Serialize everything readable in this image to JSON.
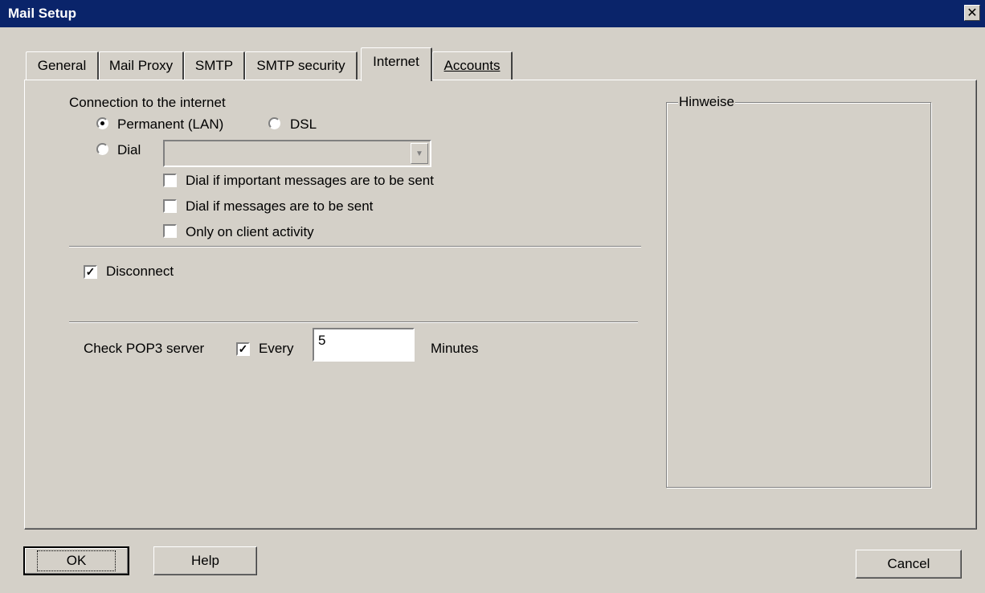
{
  "window": {
    "title": "Mail Setup",
    "close_symbol": "✕"
  },
  "tabs": [
    {
      "label": "General"
    },
    {
      "label": "Mail Proxy"
    },
    {
      "label": "SMTP"
    },
    {
      "label": "SMTP security"
    },
    {
      "label": "Internet",
      "active": true
    },
    {
      "label": "Accounts"
    }
  ],
  "internet": {
    "connection_label": "Connection to the internet",
    "radio_permanent": "Permanent (LAN)",
    "radio_dsl": "DSL",
    "radio_dial": "Dial",
    "selected_connection": "Permanent (LAN)",
    "dial_combo_value": "",
    "dial_options": [
      {
        "label": "Dial if important messages are to be sent",
        "checked": false
      },
      {
        "label": "Dial if messages are to be sent",
        "checked": false
      },
      {
        "label": "Only on client activity",
        "checked": false
      }
    ],
    "disconnect_label": "Disconnect",
    "disconnect_checked": true,
    "pop3_label": "Check POP3 server",
    "every_label": "Every",
    "every_checked": true,
    "interval_value": "5",
    "minutes_label": "Minutes"
  },
  "hints": {
    "legend": "Hinweise"
  },
  "buttons": {
    "ok": "OK",
    "help": "Help",
    "cancel": "Cancel"
  },
  "check_mark": "✓",
  "colors": {
    "face": "#d4d0c8",
    "titlebar": "#0a246a",
    "window_bg": "#ffffff"
  }
}
